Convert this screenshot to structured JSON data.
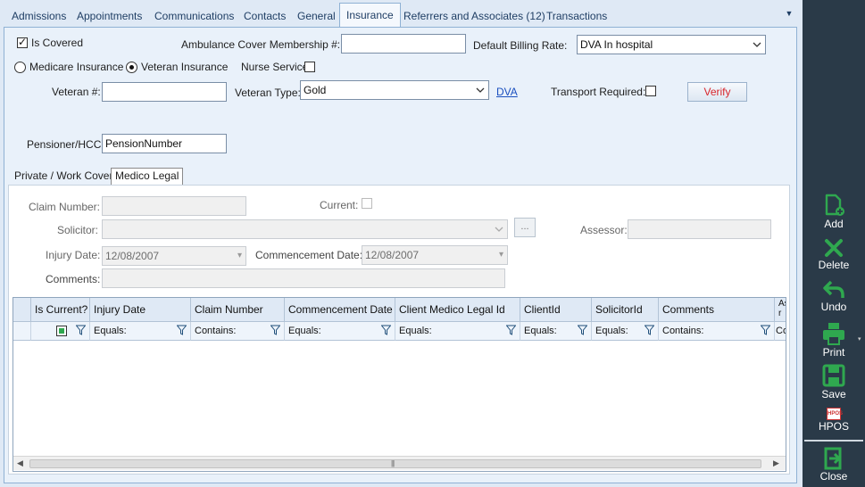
{
  "tabs": [
    {
      "label": "Admissions"
    },
    {
      "label": "Appointments"
    },
    {
      "label": "Communications"
    },
    {
      "label": "Contacts"
    },
    {
      "label": "General"
    },
    {
      "label": "Insurance"
    },
    {
      "label": "Referrers and Associates (12)"
    },
    {
      "label": "Transactions"
    }
  ],
  "insurance": {
    "is_covered_label": "Is Covered",
    "ambulance_label": "Ambulance Cover Membership #:",
    "ambulance_value": "",
    "billing_rate_label": "Default Billing Rate:",
    "billing_rate_value": "DVA In hospital",
    "medicare_label": "Medicare Insurance",
    "veteran_insurance_label": "Veteran Insurance",
    "nurse_service_label": "Nurse Service",
    "veteran_num_label": "Veteran #:",
    "veteran_num_value": "",
    "veteran_type_label": "Veteran Type:",
    "veteran_type_value": "Gold",
    "dva_link": "DVA",
    "transport_label": "Transport Required:",
    "verify_button": "Verify",
    "pensioner_label": "Pensioner/HCC:",
    "pensioner_value": "PensionNumber"
  },
  "inner_tabs": [
    {
      "label": "Private / Work Cover"
    },
    {
      "label": "Medico Legal"
    }
  ],
  "medico_legal": {
    "claim_number_label": "Claim Number:",
    "current_label": "Current:",
    "solicitor_label": "Solicitor:",
    "solicitor_browse": "...",
    "assessor_label": "Assessor:",
    "injury_date_label": "Injury Date:",
    "injury_date_value": "12/08/2007",
    "commencement_label": "Commencement Date:",
    "commencement_value": "12/08/2007",
    "comments_label": "Comments:"
  },
  "grid": {
    "columns": [
      "Is Current?",
      "Injury Date",
      "Claim Number",
      "Commencement Date",
      "Client Medico Legal Id",
      "ClientId",
      "SolicitorId",
      "Comments",
      "As r"
    ],
    "filters": [
      "",
      "Equals:",
      "Contains:",
      "Equals:",
      "Equals:",
      "Equals:",
      "Equals:",
      "Contains:",
      "Co"
    ]
  },
  "actions": [
    {
      "label": "Add"
    },
    {
      "label": "Delete"
    },
    {
      "label": "Undo"
    },
    {
      "label": "Print"
    },
    {
      "label": "Save"
    },
    {
      "label": "HPOS"
    },
    {
      "label": "Close"
    }
  ],
  "hpos_logo_text": "HPOS",
  "colors": {
    "accent_green": "#2fa84f",
    "sidebar": "#2a3a48",
    "link": "#1a4fbf",
    "verify_text": "#d8262c"
  }
}
